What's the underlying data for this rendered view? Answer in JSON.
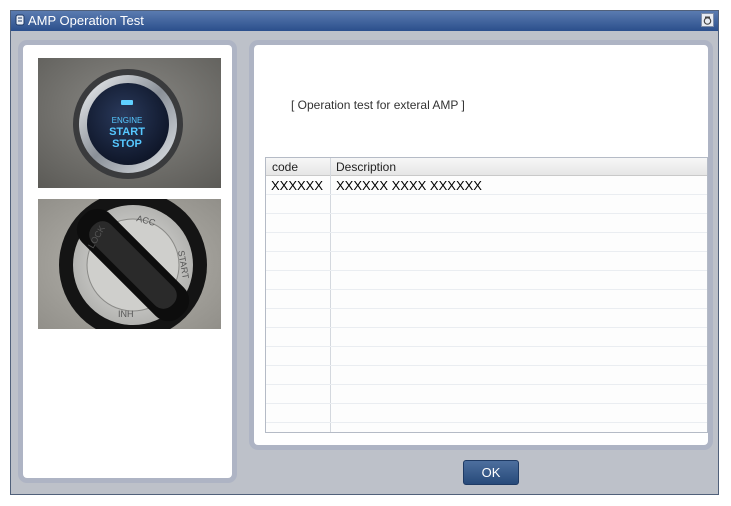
{
  "window": {
    "title": "AMP Operation Test"
  },
  "images": {
    "engine_button": "ENGINE START STOP",
    "ignition_key": "ignition key cylinder"
  },
  "main": {
    "caption": "[ Operation test for exteral AMP ]",
    "table": {
      "headers": [
        "code",
        "Description"
      ],
      "rows": [
        [
          "XXXXXX",
          "XXXXXX XXXX XXXXXX"
        ]
      ]
    }
  },
  "footer": {
    "ok_label": "OK"
  }
}
